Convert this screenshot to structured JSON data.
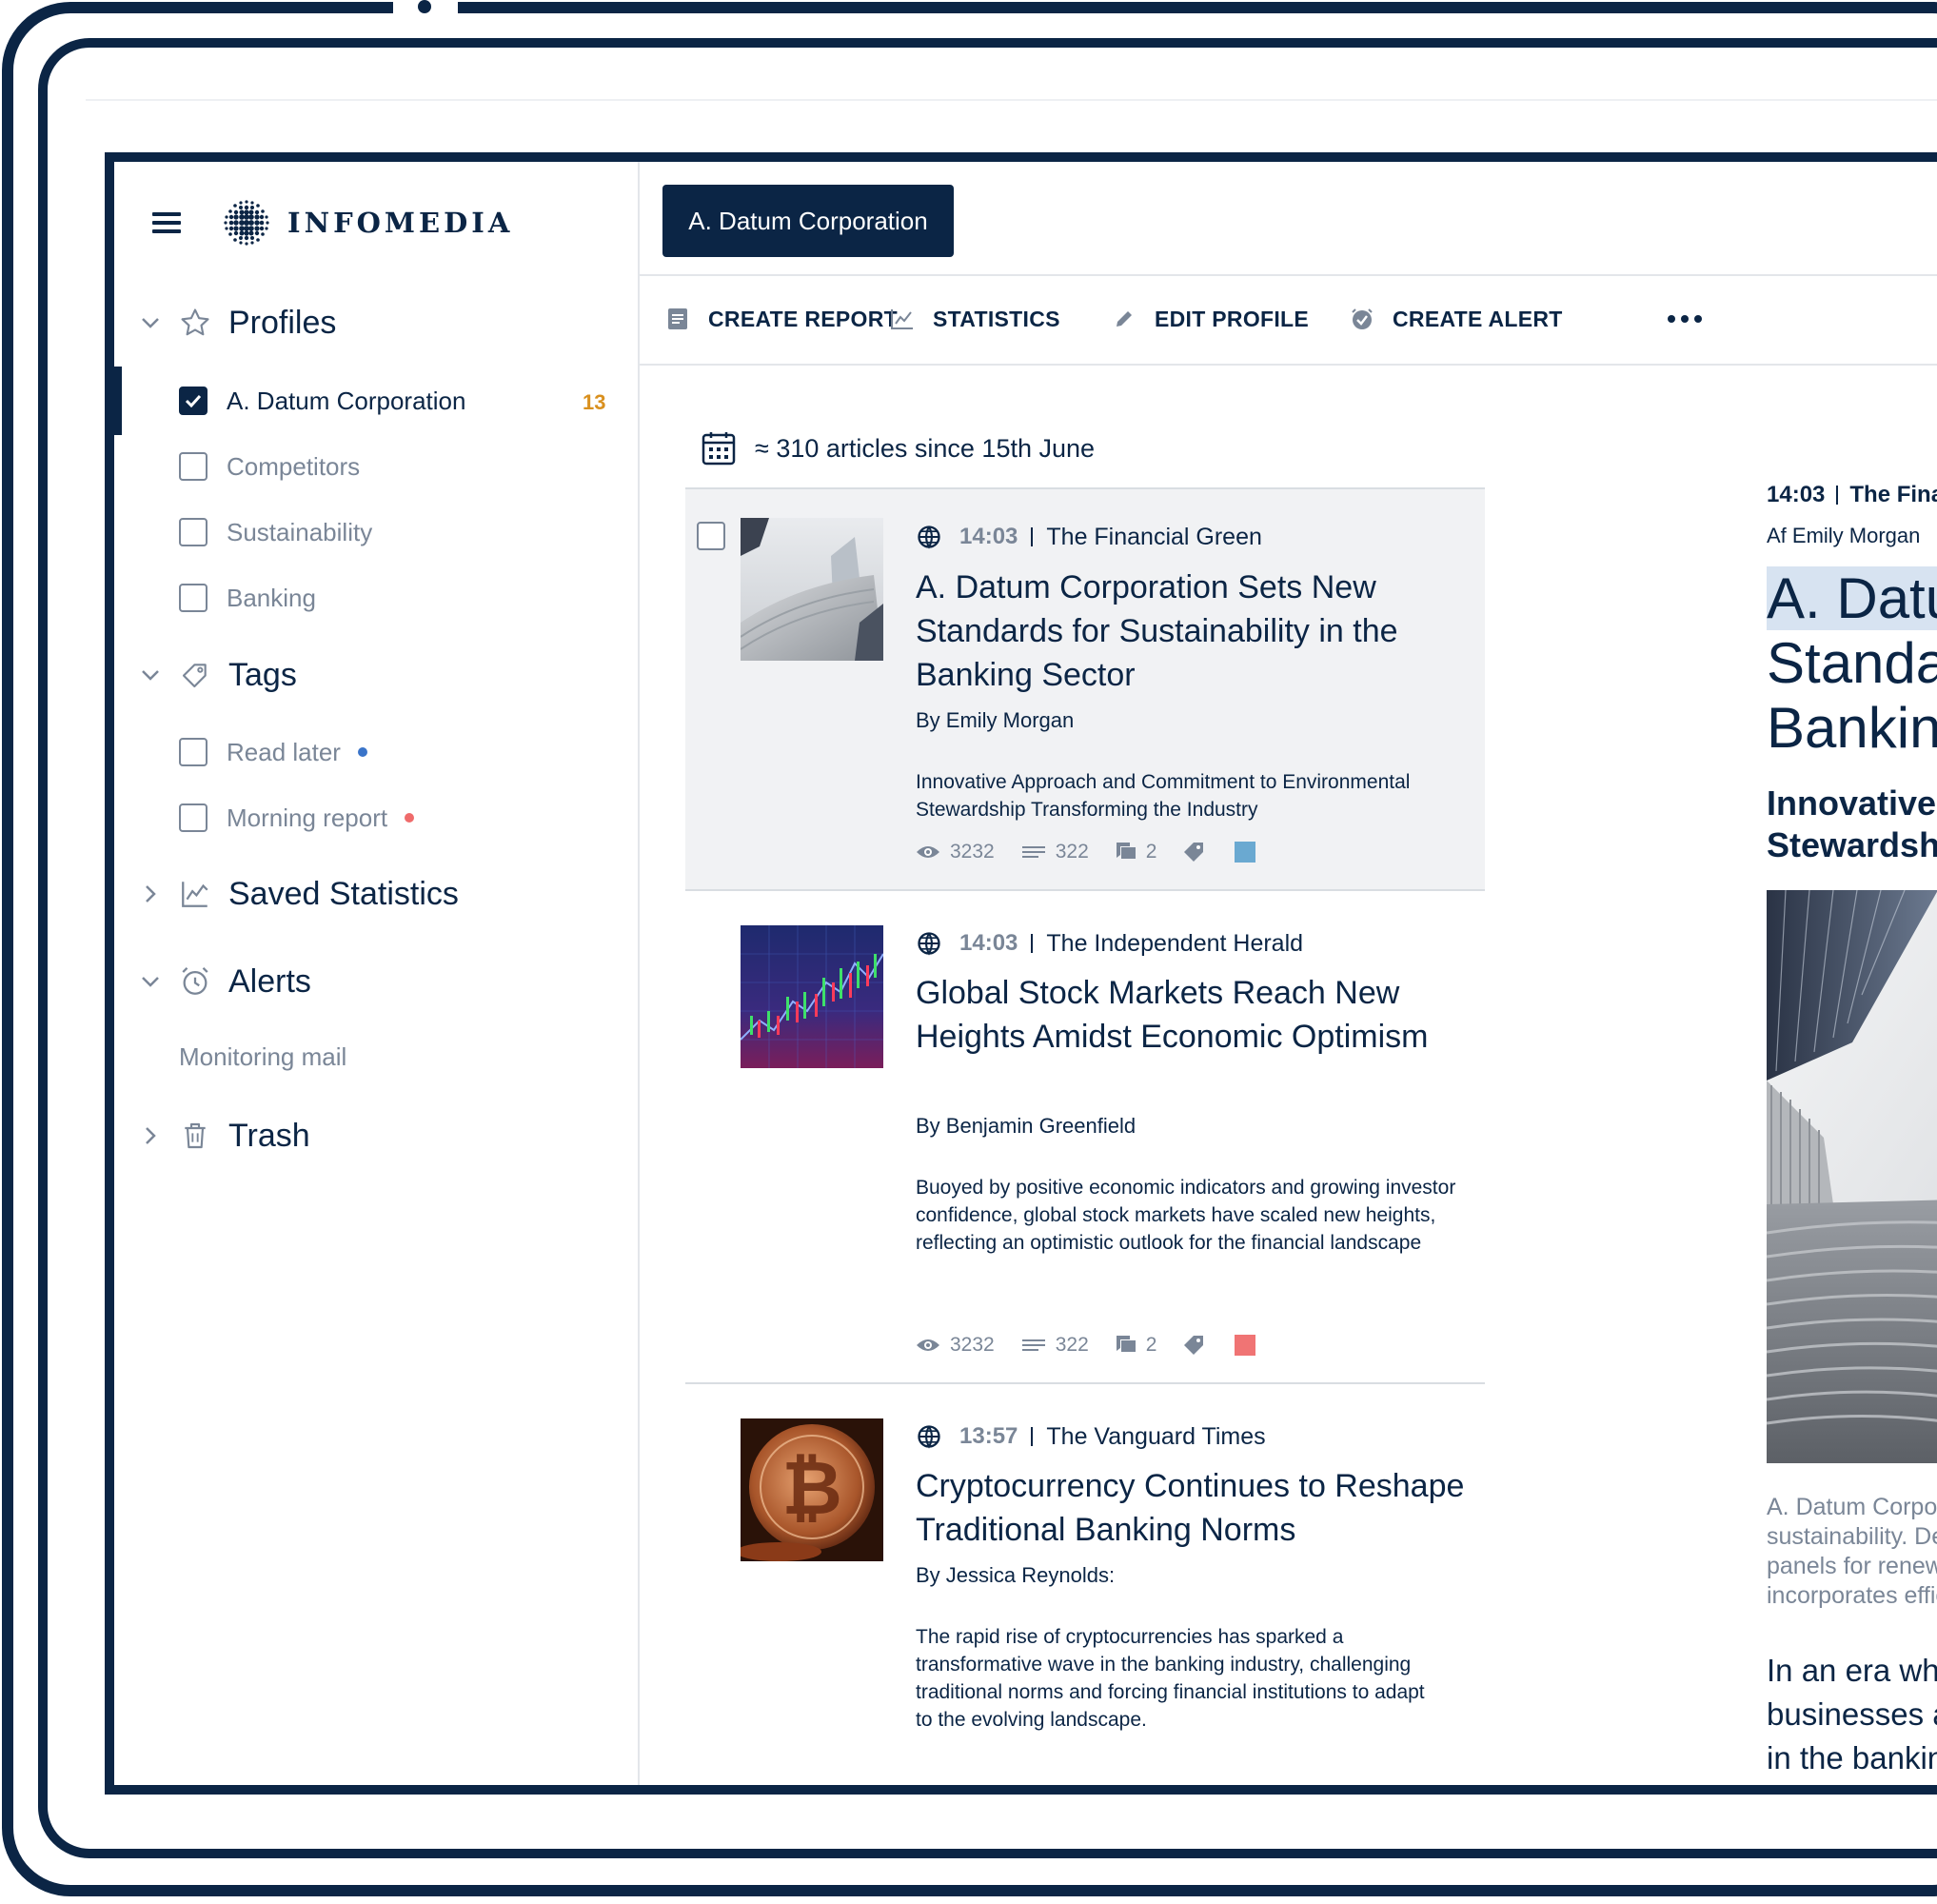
{
  "brand": {
    "name": "INFOMEDIA"
  },
  "tab": {
    "active_label": "A. Datum Corporation"
  },
  "sidebar": {
    "profiles": {
      "label": "Profiles",
      "items": [
        {
          "label": "A. Datum Corporation",
          "checked": true,
          "count": "13"
        },
        {
          "label": "Competitors",
          "checked": false
        },
        {
          "label": "Sustainability",
          "checked": false
        },
        {
          "label": "Banking",
          "checked": false
        }
      ]
    },
    "tags": {
      "label": "Tags",
      "items": [
        {
          "label": "Read later",
          "dot_color": "#3a74c9"
        },
        {
          "label": "Morning report",
          "dot_color": "#ef6b6b"
        }
      ]
    },
    "saved_statistics": {
      "label": "Saved Statistics"
    },
    "alerts": {
      "label": "Alerts",
      "items": [
        {
          "label": "Monitoring mail"
        }
      ]
    },
    "trash": {
      "label": "Trash"
    }
  },
  "toolbar": {
    "create_report": "CREATE REPORT",
    "statistics": "STATISTICS",
    "edit_profile": "EDIT PROFILE",
    "create_alert": "CREATE ALERT"
  },
  "list": {
    "count_text": "≈ 310 articles since 15th June",
    "articles": [
      {
        "time": "14:03",
        "source": "The Financial Green",
        "headline": "A. Datum Corporation Sets New Standards for Sustainability in the Banking Sector",
        "byline": "By Emily Morgan",
        "summary": "Innovative Approach and Commitment to Environmental Stewardship Transforming the Industry",
        "views": "3232",
        "words": "322",
        "comments": "2",
        "tag_color": "#6aa9d1",
        "thumb": "architecture-photo",
        "selected": true
      },
      {
        "time": "14:03",
        "source": "The Independent Herald",
        "headline": "Global Stock Markets Reach New Heights Amidst Economic Optimism",
        "byline": "By Benjamin Greenfield",
        "summary": "Buoyed by positive economic indicators and growing investor confidence, global stock markets have scaled new heights, reflecting an optimistic outlook for the financial landscape",
        "views": "3232",
        "words": "322",
        "comments": "2",
        "tag_color": "#f07474",
        "thumb": "stock-chart-photo",
        "selected": false
      },
      {
        "time": "13:57",
        "source": "The Vanguard Times",
        "headline": "Cryptocurrency Continues to Reshape Traditional Banking Norms",
        "byline": "By Jessica Reynolds:",
        "summary": "The rapid rise of cryptocurrencies has sparked a transformative wave in the banking industry, challenging traditional norms and forcing financial institutions to adapt to the evolving landscape.",
        "thumb": "bitcoin-photo",
        "selected": false
      }
    ]
  },
  "reader": {
    "time": "14:03",
    "source": "The Financial Gree",
    "author": "Af Emily Morgan",
    "title_lines": [
      "A. Datum Co",
      "Standards f",
      "Banking Sec"
    ],
    "subtitle_lines": [
      "Innovative Approa",
      "Stewardship Tran"
    ],
    "caption_lines": [
      "A. Datum Corporation's e",
      "sustainability. Designed v",
      "panels for renewable ene",
      "incorporates efficient wat"
    ],
    "body_lines": [
      "In an era where sus",
      "businesses across",
      "in the banking indus"
    ]
  }
}
